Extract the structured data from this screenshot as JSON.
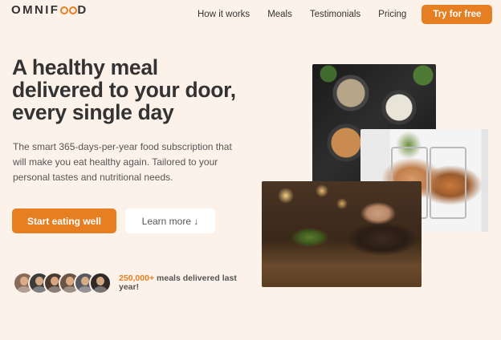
{
  "brand": {
    "prefix": "OMNIF",
    "suffix": "D"
  },
  "nav": {
    "items": [
      "How it works",
      "Meals",
      "Testimonials",
      "Pricing"
    ],
    "cta": "Try for free"
  },
  "hero": {
    "title": "A healthy meal delivered to your door, every single day",
    "description": "The smart 365-days-per-year food subscription that will make you eat healthy again. Tailored to your personal tastes and nutritional needs.",
    "primary_button": "Start eating well",
    "secondary_button": "Learn more ↓"
  },
  "delivered": {
    "count": "250,000+",
    "text": "meals delivered last year!"
  },
  "avatar_colors": [
    "#8a6a5a",
    "#3b3b3b",
    "#4a3b30",
    "#6b5444",
    "#5a5a62",
    "#2f2a28"
  ],
  "accent": "#e67e22",
  "background": "#fdf2e9"
}
